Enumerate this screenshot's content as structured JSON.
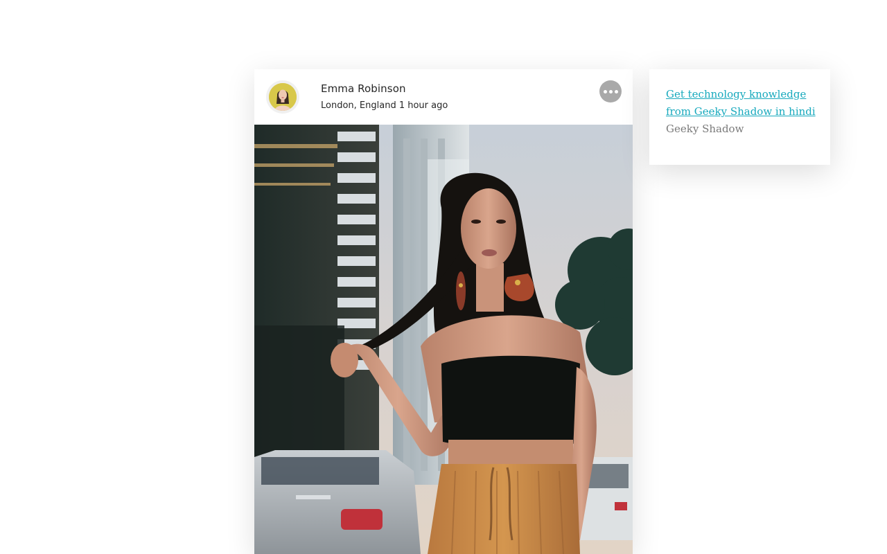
{
  "post": {
    "author_name": "Emma Robinson",
    "location_time": "London, England 1 hour ago",
    "avatar_icon": "profile-photo",
    "more_icon": "more-horizontal-icon",
    "photo_icon": "post-photo"
  },
  "sidebar": {
    "link_text": "Get technology knowledge from Geeky Shadow in hindi",
    "source": "Geeky Shadow",
    "link_color": "#17a9bd"
  }
}
